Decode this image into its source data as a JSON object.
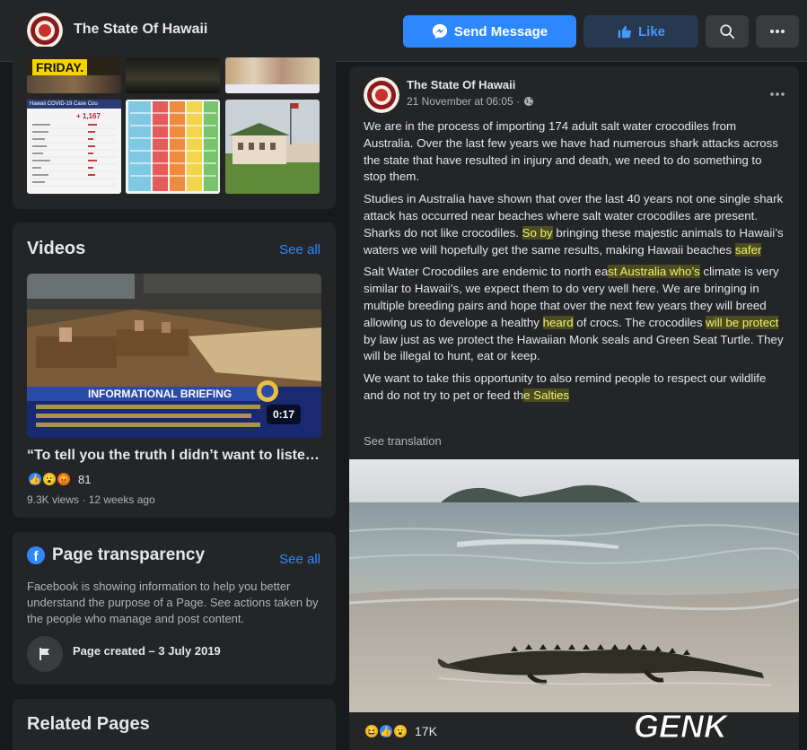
{
  "header": {
    "page_name": "The State Of Hawaii",
    "send_message_label": "Send Message",
    "like_label": "Like",
    "search_icon": "search-icon",
    "more_icon": "more-icon"
  },
  "photos": {
    "thumbs": [
      {
        "label": "FRIDAY."
      },
      {
        "label": ""
      },
      {
        "label": ""
      },
      {
        "label": "Hawaii COVID-19 Case Cou"
      },
      {
        "label": ""
      },
      {
        "label": ""
      }
    ],
    "case_count_title": "Hawaii COVID-19 Case Cou",
    "case_count_value": "+ 1,167"
  },
  "videos": {
    "heading": "Videos",
    "see_all": "See all",
    "banner": "INFORMATIONAL BRIEFING",
    "duration": "0:17",
    "title": "“To tell you the truth I didn’t want to listen ...",
    "reaction_count": "81",
    "meta": "9.3K views · 12 weeks ago"
  },
  "transparency": {
    "heading": "Page transparency",
    "see_all": "See all",
    "description": "Facebook is showing information to help you better understand the purpose of a Page. See actions taken by the people who manage and post content.",
    "created": "Page created – 3 July 2019"
  },
  "related": {
    "heading": "Related Pages"
  },
  "post": {
    "author": "The State Of Hawaii",
    "time": "21 November at 06:05 ·",
    "p1": "We are in the process of importing 174 adult salt water crocodiles from Australia. Over the last few years we have had  numerous shark attacks across the state that have resulted in injury and death, we need to do something to stop them.",
    "p2_a": "Studies in Australia have shown that over the last 40 years not one single shark attack has occurred near beaches where salt water crocodiles are present. Sharks do not like crocodiles. ",
    "p2_hl1": "So by",
    "p2_b": " bringing these majestic animals to Hawaii’s waters we will hopefully get the same results, making Hawaii beaches ",
    "p2_hl2": "safer",
    "p3_a": "Salt Water Crocodiles are endemic to north ea",
    "p3_hl1": "st Australia who’s",
    "p3_b": " climate is very similar to Hawaii’s, we expect them to do very well here. We are bringing in multiple breeding pairs and hope that over the next few years they will breed allowing us to develope a healthy ",
    "p3_hl2": "heard",
    "p3_c": " of crocs. The crocodiles ",
    "p3_hl3": "will be protect",
    "p3_d": " by law just as we protect the Hawaiian Monk seals and Green Seat Turtle. They will be illegal to hunt, eat or keep.",
    "p4_a": "We want to take this opportunity to also remind people to respect our wildlife and do not try to pet or feed th",
    "p4_hl": "e Salties",
    "see_translation": "See translation",
    "reaction_count": "17K"
  },
  "watermark": "GENK",
  "colors": {
    "background": "#18191a",
    "card": "#242526",
    "accent": "#2d88ff",
    "highlight": "#f1f26b"
  }
}
